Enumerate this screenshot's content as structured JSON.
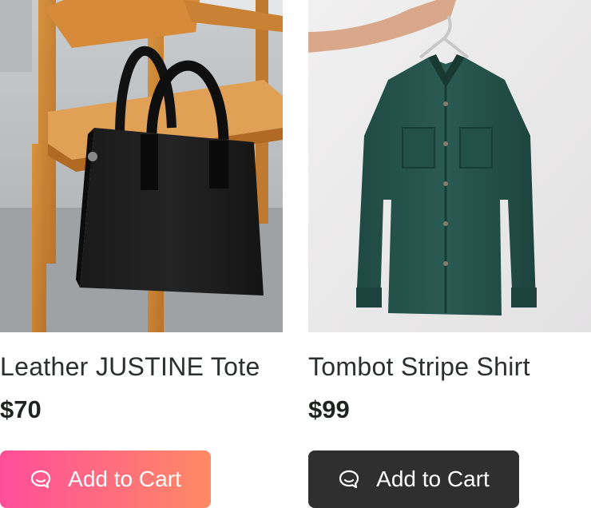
{
  "products": [
    {
      "name": "Leather JUSTINE Tote",
      "price": "$70",
      "cta_label": "Add to Cart",
      "cta_icon": "chat-bubble-icon",
      "cta_style": "gradient",
      "colors": {
        "gradient_start": "#ff4e9a",
        "gradient_end": "#ff8a63"
      }
    },
    {
      "name": "Tombot Stripe Shirt",
      "price": "$99",
      "cta_label": "Add to Cart",
      "cta_icon": "chat-bubble-icon",
      "cta_style": "dark",
      "colors": {
        "button": "#2f2f2f"
      }
    }
  ]
}
